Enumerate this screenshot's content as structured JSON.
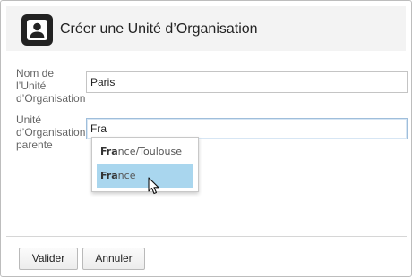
{
  "dialog": {
    "title": "Créer une Unité d’Organisation",
    "header_icon": "user-icon"
  },
  "form": {
    "name_label": "Nom de l’Unité d’Organisation",
    "name_value": "Paris",
    "parent_label": "Unité d’Organisation parente",
    "parent_value": "Fra"
  },
  "autocomplete": {
    "typed_prefix": "Fra",
    "options": [
      {
        "match": "Fra",
        "rest": "nce/Toulouse",
        "full": "France/Toulouse",
        "selected": false
      },
      {
        "match": "Fra",
        "rest": "nce",
        "full": "France",
        "selected": true
      }
    ],
    "highlight_color": "#a9d6ee"
  },
  "buttons": {
    "valider": "Valider",
    "annuler": "Annuler"
  }
}
